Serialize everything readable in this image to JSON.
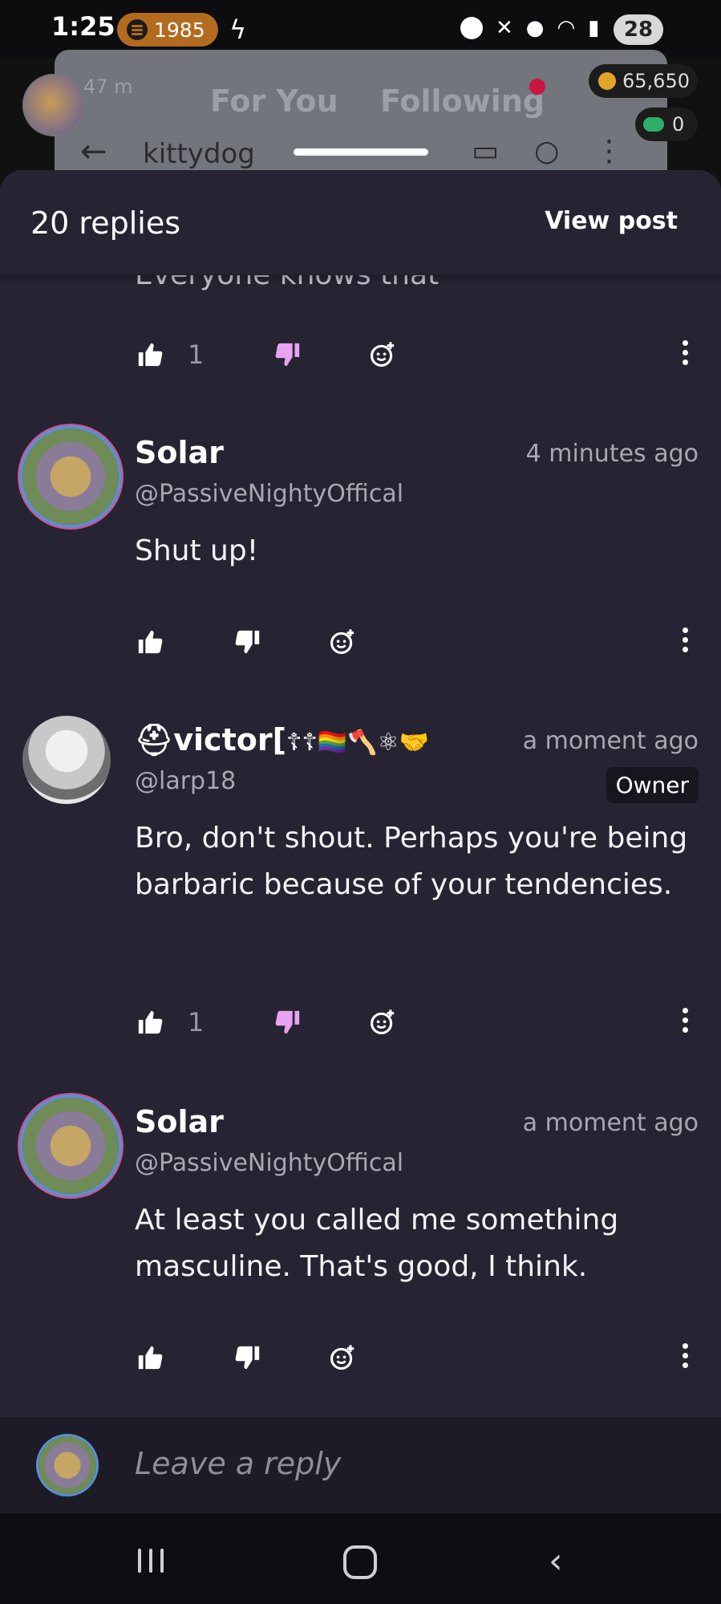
{
  "status_bar": {
    "time": "1:25",
    "spotify_count": "1985",
    "battery": "28"
  },
  "background_app": {
    "left_meta": "47 m",
    "tabs": [
      "For You",
      "Following"
    ],
    "coins": "65,650",
    "gems": "0",
    "title": "kittydog"
  },
  "sheet": {
    "replies_count": "20 replies",
    "view_post": "View post",
    "cutoff_text": "Everyone knows that"
  },
  "top_actions": {
    "likes": "1"
  },
  "comments": [
    {
      "name": "Solar",
      "handle": "@PassiveNightyOffical",
      "time": "4 minutes ago",
      "body": "Shut up!",
      "likes": ""
    },
    {
      "name": "victor[",
      "name_emojis": "☦☦🏳️‍🌈🪓⚛🤝",
      "handle": "@larp18",
      "time": "a moment ago",
      "badge": "Owner",
      "body": "Bro, don't shout. Perhaps you're being barbaric because of your tendencies.",
      "likes": "1"
    },
    {
      "name": "Solar",
      "handle": "@PassiveNightyOffical",
      "time": "a moment ago",
      "body": "At least you called me something masculine. That's good, I think.",
      "likes": ""
    }
  ],
  "composer": {
    "placeholder": "Leave a reply"
  },
  "colors": {
    "dislike_active": "#e7a3f0",
    "sheet_bg": "#262433"
  }
}
